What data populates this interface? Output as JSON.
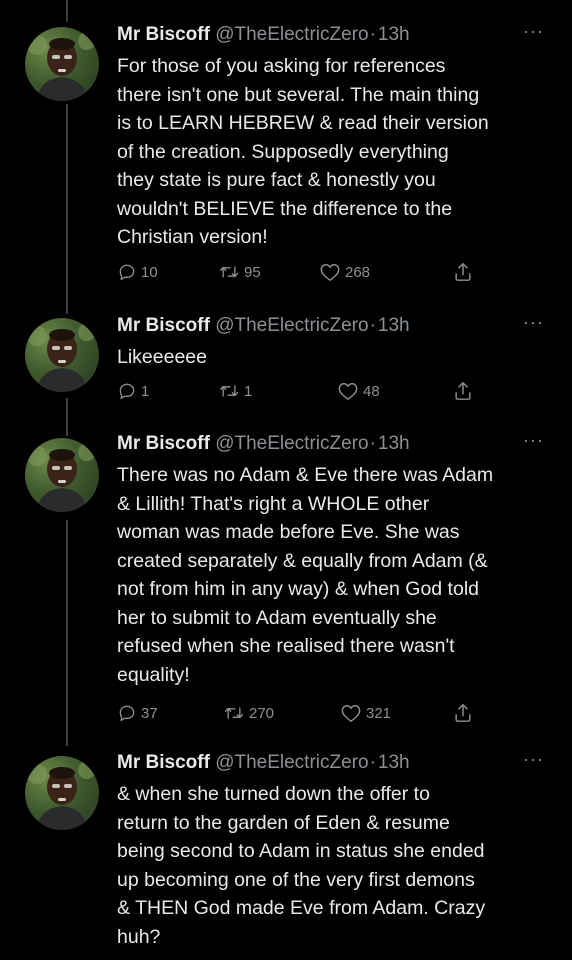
{
  "tweets": [
    {
      "display_name": "Mr Biscoff",
      "handle": "@TheElectricZero",
      "separator": "·",
      "time": "13h",
      "more": "···",
      "text": "For those of you asking for references\nthere isn't one but several. The main thing\nis to LEARN HEBREW & read their version\nof the creation. Supposedly everything\nthey state is pure fact & honestly you\nwouldn't BELIEVE the difference to the\nChristian version!",
      "replies": "10",
      "retweets": "95",
      "likes": "268"
    },
    {
      "display_name": "Mr Biscoff",
      "handle": "@TheElectricZero",
      "separator": "·",
      "time": "13h",
      "more": "···",
      "text": "Likeeeeee",
      "replies": "1",
      "retweets": "1",
      "likes": "48"
    },
    {
      "display_name": "Mr Biscoff",
      "handle": "@TheElectricZero",
      "separator": "·",
      "time": "13h",
      "more": "···",
      "text": "There was no Adam & Eve there was Adam\n& Lillith! That's right a WHOLE other\nwoman was made before Eve. She was\ncreated separately & equally from Adam (&\nnot from him in any way) & when God told\nher to submit to Adam eventually she\nrefused when she realised there wasn't\nequality!",
      "replies": "37",
      "retweets": "270",
      "likes": "321"
    },
    {
      "display_name": "Mr Biscoff",
      "handle": "@TheElectricZero",
      "separator": "·",
      "time": "13h",
      "more": "···",
      "text": "& when she turned down the offer to\nreturn to the garden of Eden & resume\nbeing second to Adam in status she ended\nup becoming one of the very first demons\n& THEN God made Eve from Adam. Crazy\nhuh?"
    }
  ],
  "icons": {
    "reply": "reply-icon",
    "retweet": "retweet-icon",
    "like": "heart-icon",
    "share": "share-icon"
  },
  "colors": {
    "background": "#000000",
    "text": "#e7e9ea",
    "secondary": "#8b9095",
    "thread_line": "#3a3d40"
  }
}
